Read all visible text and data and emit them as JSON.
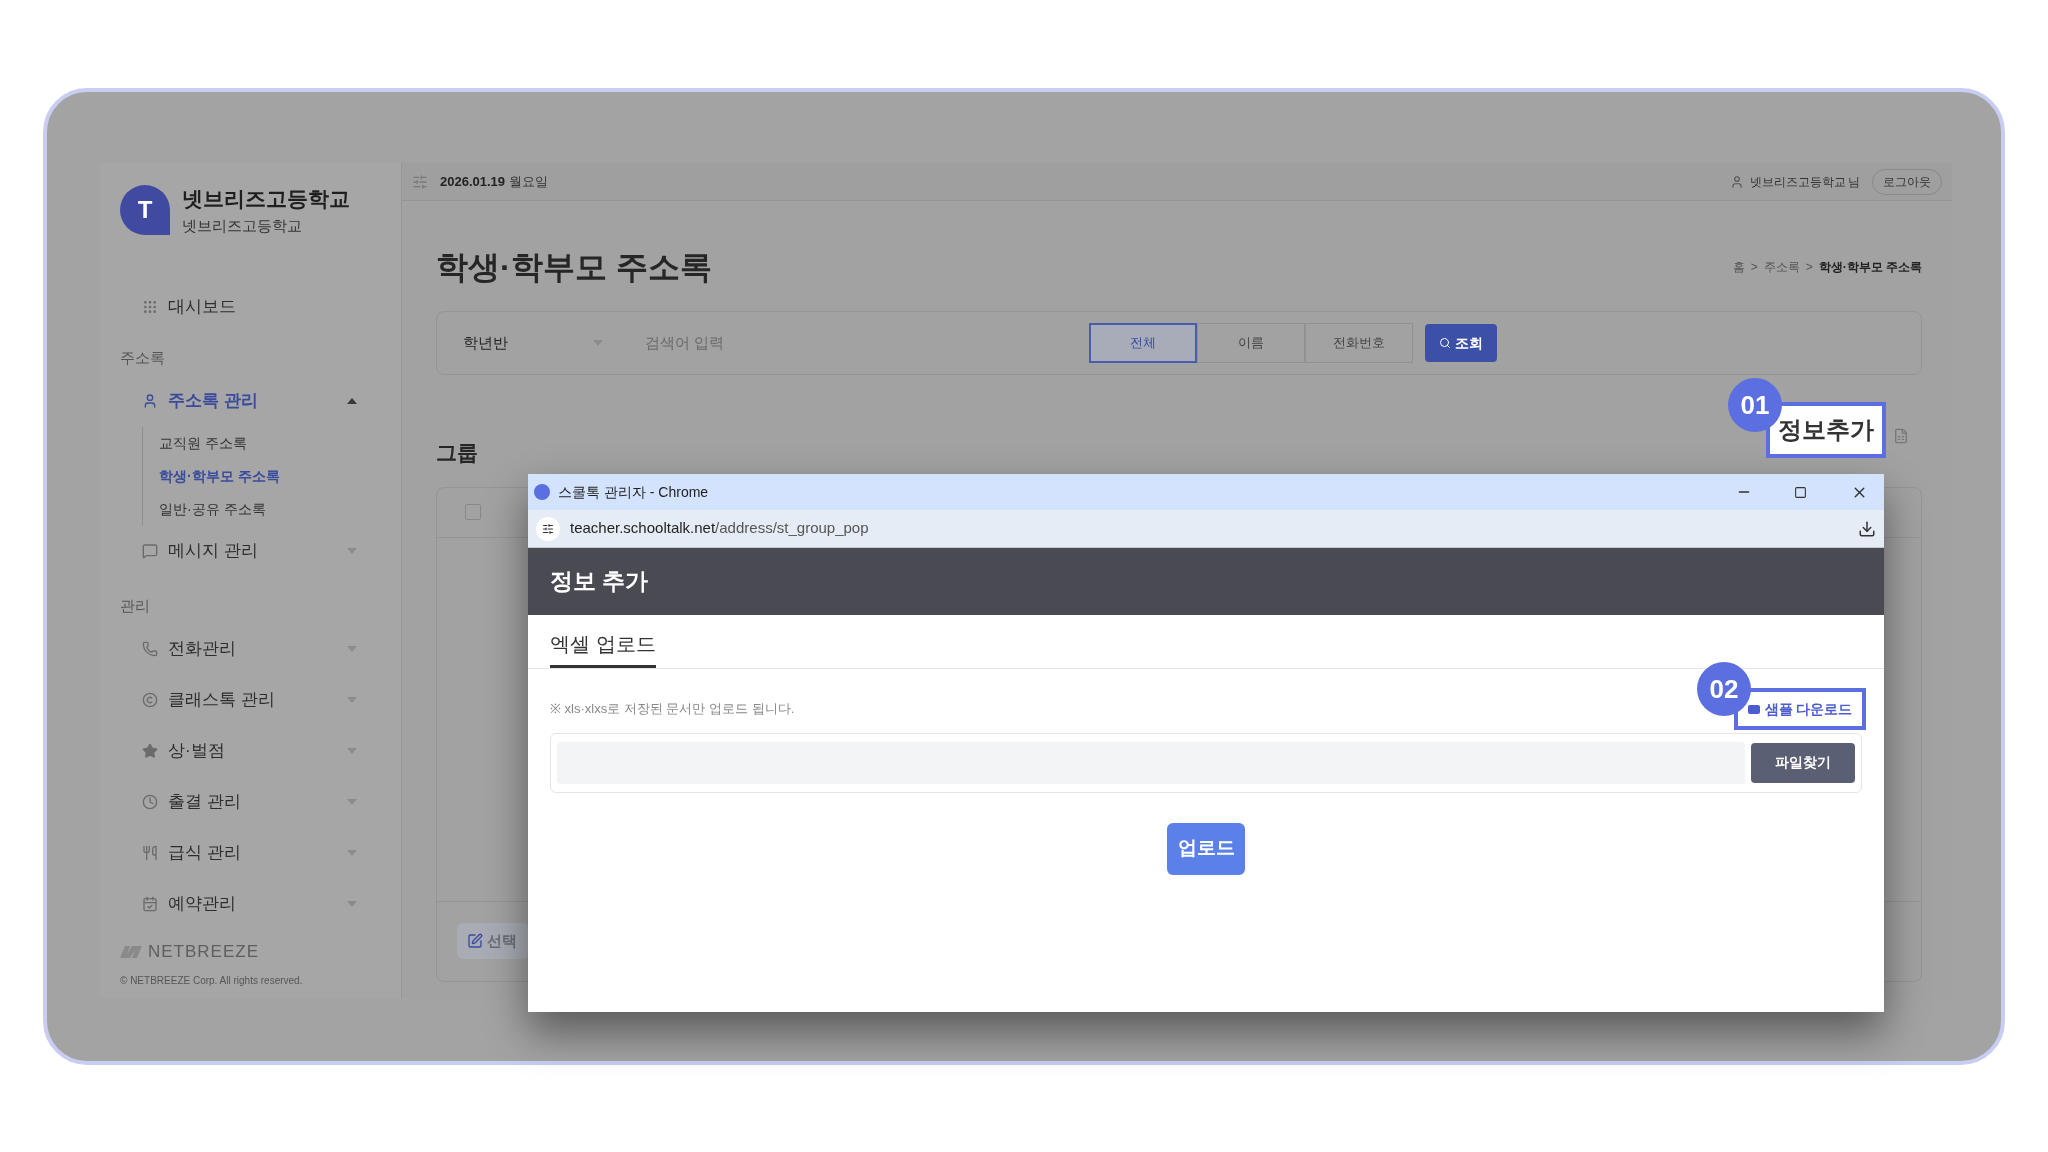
{
  "sidebar": {
    "logo_letter": "T",
    "school_name": "넷브리즈고등학교",
    "school_sub": "넷브리즈고등학교",
    "nav": [
      {
        "kind": "link",
        "label": "대시보드"
      },
      {
        "kind": "heading",
        "label": "주소록"
      },
      {
        "kind": "menu",
        "label": "주소록 관리",
        "expanded": true,
        "selected": true,
        "children": [
          {
            "label": "교직원 주소록",
            "selected": false
          },
          {
            "label": "학생·학부모 주소록",
            "selected": true
          },
          {
            "label": "일반·공유 주소록",
            "selected": false
          }
        ]
      },
      {
        "kind": "menu",
        "label": "메시지 관리",
        "expanded": false,
        "selected": false
      },
      {
        "kind": "heading",
        "label": "관리"
      },
      {
        "kind": "menu",
        "label": "전화관리",
        "expanded": false,
        "selected": false
      },
      {
        "kind": "menu",
        "label": "클래스톡 관리",
        "expanded": false,
        "selected": false
      },
      {
        "kind": "menu",
        "label": "상·벌점",
        "expanded": false,
        "selected": false
      },
      {
        "kind": "menu",
        "label": "출결 관리",
        "expanded": false,
        "selected": false
      },
      {
        "kind": "menu",
        "label": "급식 관리",
        "expanded": false,
        "selected": false
      },
      {
        "kind": "menu",
        "label": "예약관리",
        "expanded": false,
        "selected": false
      }
    ],
    "brand": "NETBREEZE",
    "copyright": "© NETBREEZE Corp. All rights reserved."
  },
  "topbar": {
    "date": "2026.01.19",
    "weekday": "월요일",
    "user": "넷브리즈고등학교",
    "user_suffix": "님",
    "logout": "로그아웃"
  },
  "page": {
    "title": "학생·학부모 주소록",
    "separator": ">",
    "breadcrumb": [
      "홈",
      "주소록",
      "학생·학부모 주소록"
    ]
  },
  "search": {
    "select": "학년반",
    "placeholder": "검색어 입력",
    "filters": [
      {
        "label": "전체",
        "selected": true
      },
      {
        "label": "이름",
        "selected": false
      },
      {
        "label": "전화번호",
        "selected": false
      }
    ],
    "button": "조회"
  },
  "group": {
    "title": "그룹",
    "edit_button": "선택",
    "select_all_checked": false
  },
  "add_info": {
    "callout": "01",
    "label": "정보추가"
  },
  "popup": {
    "window_title": "스쿨톡 관리자 - Chrome",
    "url_host": "teacher.schooltalk.net",
    "url_path": "/address/st_group_pop",
    "header": "정보 추가",
    "tabs": [
      {
        "label": "엑셀 업로드",
        "selected": true
      }
    ],
    "note": "※ xls·xlxs로 저장된 문서만 업로드 됩니다.",
    "sample": {
      "callout": "02",
      "label": "샘플 다운로드"
    },
    "browse_button": "파일찾기",
    "upload_button": "업로드"
  }
}
